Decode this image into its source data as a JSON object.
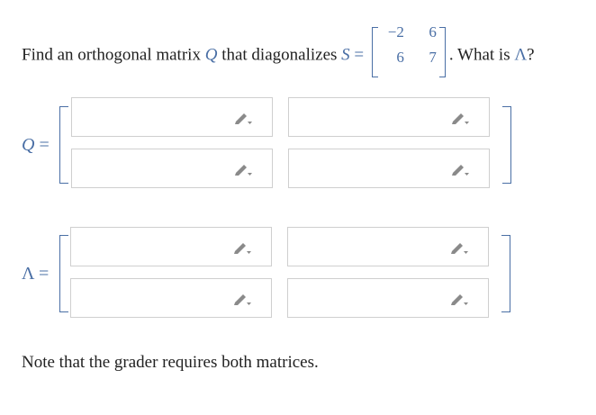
{
  "question": {
    "text_before": "Find an orthogonal matrix ",
    "q_symbol": "Q",
    "text_middle": " that diagonalizes ",
    "s_symbol": "S",
    "equals": " = ",
    "s_matrix": [
      "−2",
      "6",
      "6",
      "7"
    ],
    "text_after": ". What is ",
    "lambda_symbol": "Λ",
    "text_end": "?"
  },
  "q_matrix": {
    "label_symbol": "Q",
    "label_equals": " =",
    "cells": [
      "",
      "",
      "",
      ""
    ]
  },
  "lambda_matrix": {
    "label_symbol": "Λ",
    "label_equals": " =",
    "cells": [
      "",
      "",
      "",
      ""
    ]
  },
  "note": "Note that the grader requires both matrices.",
  "colors": {
    "math": "#4a6fa5",
    "input_border": "#cfcfcf",
    "icon": "#8a8a8a"
  },
  "icons": {
    "edit": "pencil-icon"
  }
}
